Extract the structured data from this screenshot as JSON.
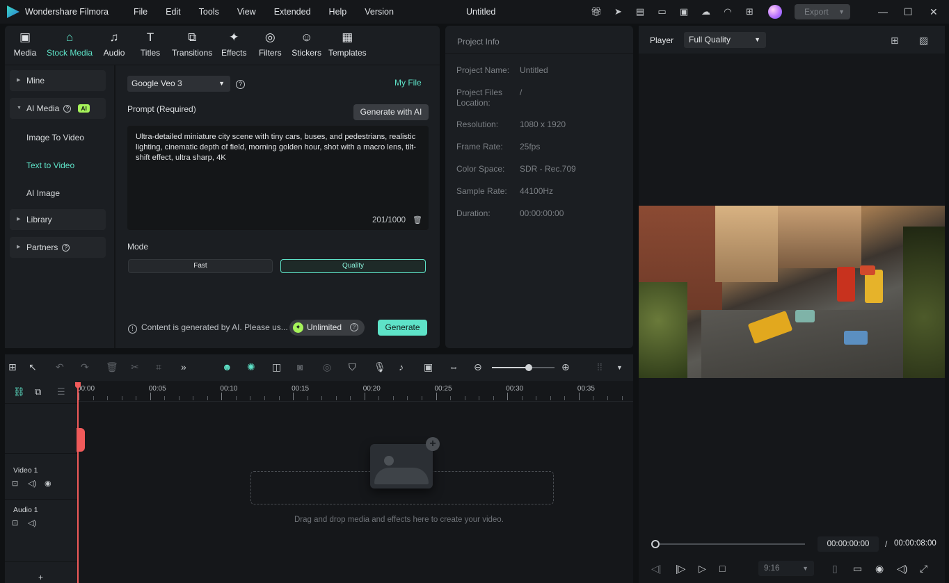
{
  "app": {
    "name": "Wondershare Filmora",
    "document_title": "Untitled"
  },
  "menu": [
    "File",
    "Edit",
    "Tools",
    "View",
    "Extended",
    "Help",
    "Version"
  ],
  "titlebar": {
    "icons": [
      "gift-icon",
      "send-icon",
      "news-icon",
      "layout-icon",
      "save-icon",
      "cloud-upload-icon",
      "headset-icon",
      "apps-icon"
    ],
    "export_label": "Export"
  },
  "tabs": [
    {
      "label": "Media",
      "icon": "media-icon",
      "active": false
    },
    {
      "label": "Stock Media",
      "icon": "stock-media-icon",
      "active": true
    },
    {
      "label": "Audio",
      "icon": "audio-icon",
      "active": false
    },
    {
      "label": "Titles",
      "icon": "titles-icon",
      "active": false
    },
    {
      "label": "Transitions",
      "icon": "transitions-icon",
      "active": false
    },
    {
      "label": "Effects",
      "icon": "effects-icon",
      "active": false
    },
    {
      "label": "Filters",
      "icon": "filters-icon",
      "active": false
    },
    {
      "label": "Stickers",
      "icon": "stickers-icon",
      "active": false
    },
    {
      "label": "Templates",
      "icon": "templates-icon",
      "active": false
    }
  ],
  "sidebar": {
    "mine": "Mine",
    "ai_media": "AI Media",
    "ai_badge": "AI",
    "sub_items": [
      "Image To Video",
      "Text to Video",
      "AI Image"
    ],
    "active_sub": "Text to Video",
    "library": "Library",
    "partners": "Partners"
  },
  "generator": {
    "model": "Google Veo 3",
    "my_file": "My File",
    "prompt_label": "Prompt (Required)",
    "generate_with_ai": "Generate with AI",
    "prompt_text": "Ultra-detailed miniature city scene with tiny cars, buses, and pedestrians, realistic lighting, cinematic depth of field, morning golden hour, shot with a macro lens, tilt-shift effect, ultra sharp, 4K",
    "char_count": "201/1000",
    "mode_label": "Mode",
    "mode_fast": "Fast",
    "mode_quality": "Quality",
    "selected_mode": "Quality",
    "notice": "Content is generated by AI. Please us...",
    "unlimited": "Unlimited",
    "generate": "Generate"
  },
  "project_info": {
    "title": "Project Info",
    "rows": [
      {
        "key": "Project Name:",
        "value": "Untitled"
      },
      {
        "key": "Project Files Location:",
        "value": "/"
      },
      {
        "key": "Resolution:",
        "value": "1080 x 1920"
      },
      {
        "key": "Frame Rate:",
        "value": "25fps"
      },
      {
        "key": "Color Space:",
        "value": "SDR - Rec.709"
      },
      {
        "key": "Sample Rate:",
        "value": "44100Hz"
      },
      {
        "key": "Duration:",
        "value": "00:00:00:00"
      }
    ]
  },
  "player": {
    "label": "Player",
    "quality": "Full Quality",
    "current_time": "00:00:00:00",
    "separator": "/",
    "total_time": "00:00:08:00",
    "aspect_ratio": "9:16",
    "progress": 0
  },
  "timeline": {
    "ruler_labels": [
      "00:00",
      "00:05",
      "00:10",
      "00:15",
      "00:20",
      "00:25",
      "00:30",
      "00:35"
    ],
    "tracks": [
      {
        "name": "Video 1"
      },
      {
        "name": "Audio 1"
      }
    ],
    "drop_text": "Drag and drop media and effects here to create your video.",
    "add_track": "+"
  },
  "colors": {
    "accent": "#5ee3c8",
    "ai_badge": "#a6f35a",
    "playhead": "#f05a5a"
  }
}
